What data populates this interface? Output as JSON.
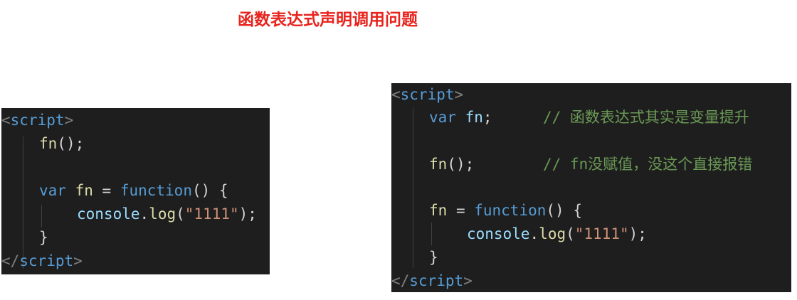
{
  "title": "函数表达式声明调用问题",
  "left_code": {
    "open_lt": "<",
    "open_tag": "script",
    "open_gt": ">",
    "call_fn": "fn",
    "call_punct": "();",
    "var_kw": "var",
    "var_name": "fn",
    "eq": " = ",
    "function_kw": "function",
    "func_punct": "() {",
    "console_obj": "console",
    "dot": ".",
    "log_fn": "log",
    "paren_open": "(",
    "string_val": "\"1111\"",
    "paren_close": ");",
    "close_brace": "}",
    "close_lt": "</",
    "close_tag": "script",
    "close_gt": ">"
  },
  "right_code": {
    "open_lt": "<",
    "open_tag": "script",
    "open_gt": ">",
    "var_kw": "var",
    "var_name": "fn",
    "semi": ";",
    "comment1": "// 函数表达式其实是变量提升",
    "call_fn": "fn",
    "call_punct": "();",
    "comment2": "// fn没赋值，没这个直接报错",
    "assign_name": "fn",
    "eq": " = ",
    "function_kw": "function",
    "func_punct": "() {",
    "console_obj": "console",
    "dot": ".",
    "log_fn": "log",
    "paren_open": "(",
    "string_val": "\"1111\"",
    "paren_close": ");",
    "close_brace": "}",
    "close_lt": "</",
    "close_tag": "script",
    "close_gt": ">"
  }
}
